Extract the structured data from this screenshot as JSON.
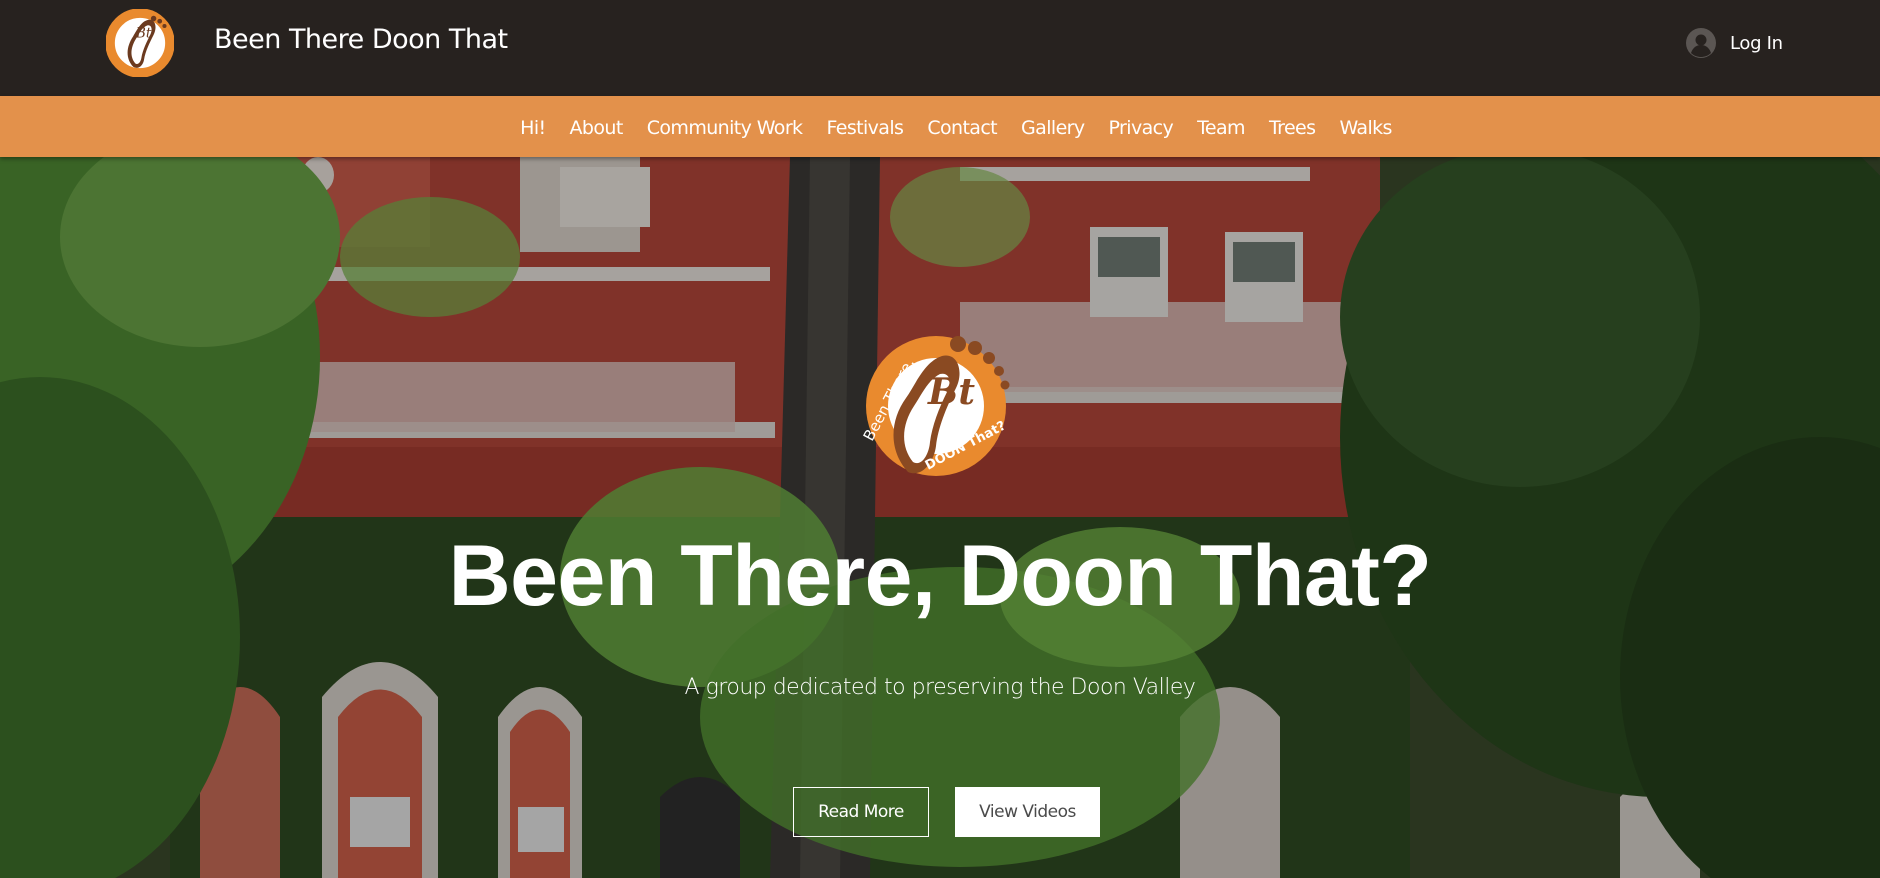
{
  "header": {
    "site_title": "Been There Doon That",
    "login_label": "Log In",
    "logo_icon": "footprint-logo-icon",
    "avatar_icon": "user-avatar-icon"
  },
  "nav": {
    "items": [
      {
        "label": "Hi!"
      },
      {
        "label": "About"
      },
      {
        "label": "Community Work"
      },
      {
        "label": "Festivals"
      },
      {
        "label": "Contact"
      },
      {
        "label": "Gallery"
      },
      {
        "label": "Privacy"
      },
      {
        "label": "Team"
      },
      {
        "label": "Trees"
      },
      {
        "label": "Walks"
      }
    ]
  },
  "hero": {
    "title": "Been There, Doon That?",
    "subtitle": "A group dedicated to preserving the Doon Valley",
    "read_more_label": "Read More",
    "view_videos_label": "View Videos",
    "logo_text_left": "Been There,",
    "logo_text_bottom": "DOON That?",
    "logo_monogram": "Bt"
  },
  "colors": {
    "topbar": "#27221f",
    "navbar": "#e3914b",
    "accent_orange": "#e98a2e",
    "building_red": "#b2463a",
    "foliage_green": "#3f6a2c"
  }
}
